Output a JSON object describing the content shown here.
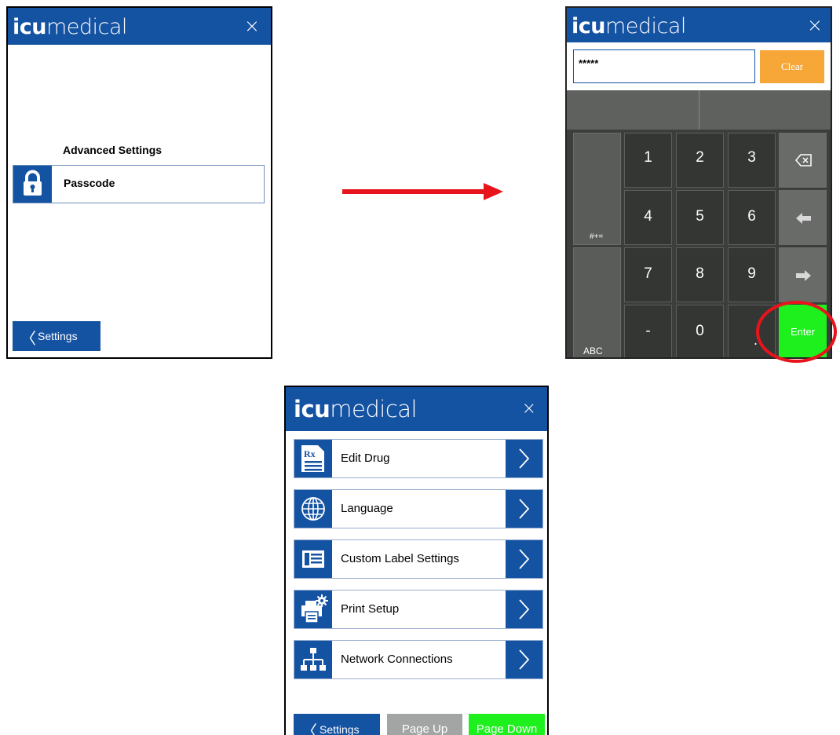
{
  "brand": {
    "bold": "icu",
    "light": "medical",
    "close_glyph": "×"
  },
  "screen1": {
    "section_title": "Advanced Settings",
    "item_label": "Passcode",
    "item_icon": "padlock-icon",
    "back_label": "Settings",
    "back_glyph": "〈"
  },
  "screen2": {
    "passcode_value": "*****",
    "clear_label": "Clear",
    "keys": {
      "k1": "1",
      "k2": "2",
      "k3": "3",
      "k4": "4",
      "k5": "5",
      "k6": "6",
      "k7": "7",
      "k8": "8",
      "k9": "9",
      "minus": "-",
      "k0": "0",
      "dot": ".",
      "symbols": "#+=",
      "abc": "ABC",
      "enter": "Enter"
    },
    "func_icons": [
      "backspace-icon",
      "left-arrow-icon",
      "right-arrow-icon"
    ]
  },
  "screen3": {
    "menu": [
      {
        "label": "Edit Drug",
        "icon": "rx-document-icon"
      },
      {
        "label": "Language",
        "icon": "globe-icon"
      },
      {
        "label": "Custom Label Settings",
        "icon": "label-icon"
      },
      {
        "label": "Print Setup",
        "icon": "printer-gear-icon"
      },
      {
        "label": "Network Connections",
        "icon": "network-icon"
      }
    ],
    "back_label": "Settings",
    "back_glyph": "〈",
    "page_up": "Page Up",
    "page_down": "Page Down"
  },
  "colors": {
    "brand_blue": "#1452a2",
    "clear_orange": "#f6a738",
    "enter_green": "#1ef01e",
    "page_down_green": "#1ef01e",
    "page_up_gray": "#a3a5a5",
    "highlight_red": "#e8141b"
  }
}
